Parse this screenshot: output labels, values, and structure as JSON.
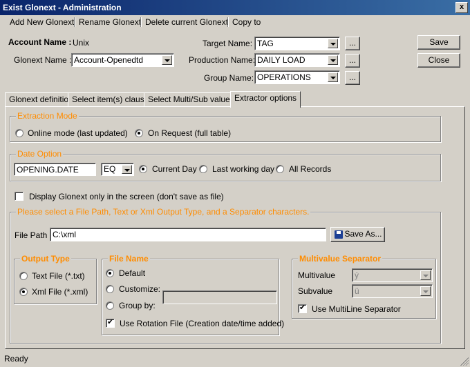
{
  "window": {
    "title": "Exist Glonext - Administration",
    "close_glyph": "x"
  },
  "menu": {
    "add": "Add New Glonext",
    "rename": "Rename Glonext",
    "delete": "Delete current Glonext",
    "copy": "Copy to"
  },
  "header": {
    "account_label": "Account Name :",
    "account_value": "Unix",
    "glonext_label": "Glonext Name :",
    "glonext_value": "Account-Openedtd",
    "target_label": "Target Name:",
    "target_value": "TAG",
    "production_label": "Production Name:",
    "production_value": "DAILY LOAD",
    "group_label": "Group Name:",
    "group_value": "OPERATIONS",
    "ellipsis": "...",
    "save": "Save",
    "close": "Close"
  },
  "tabs": [
    {
      "label": "Glonext definition"
    },
    {
      "label": "Select item(s) clause"
    },
    {
      "label": "Select Multi/Sub values"
    },
    {
      "label": "Extractor options"
    }
  ],
  "extraction": {
    "title": "Extraction Mode",
    "online": "Online mode (last updated)",
    "on_request": "On Request (full table)",
    "selected": "on_request"
  },
  "date_option": {
    "title": "Date Option",
    "field_value": "OPENING.DATE",
    "operator": "EQ",
    "current_day": "Current Day",
    "last_working": "Last working day",
    "all_records": "All Records",
    "selected": "current_day"
  },
  "display_only": {
    "label": "Display Glonext only in the screen (don't save as file)",
    "checked": false
  },
  "output_section": {
    "title": "Please select a File Path, Text or Xml Output Type, and a Separator characters.",
    "file_path_label": "File Path",
    "file_path_value": "C:\\xml",
    "save_as": "Save As..."
  },
  "output_type": {
    "title": "Output Type",
    "text": "Text File (*.txt)",
    "xml": "Xml File (*.xml)",
    "selected": "xml"
  },
  "file_name": {
    "title": "File Name",
    "default": "Default",
    "customize": "Customize:",
    "group_by": "Group by:",
    "selected": "default",
    "rotation": "Use Rotation File (Creation date/time added)",
    "rotation_checked": true
  },
  "multivalue": {
    "title": "Multivalue Separator",
    "multivalue_label": "Multivalue",
    "multivalue_value": "ý",
    "subvalue_label": "Subvalue",
    "subvalue_value": "ü",
    "multiline_label": "Use MultiLine Separator",
    "multiline_checked": true
  },
  "status": {
    "text": "Ready"
  },
  "colors": {
    "accent": "#ff8c00",
    "face": "#d4d0c8",
    "title_start": "#0a246a",
    "title_end": "#3a6ea5"
  }
}
